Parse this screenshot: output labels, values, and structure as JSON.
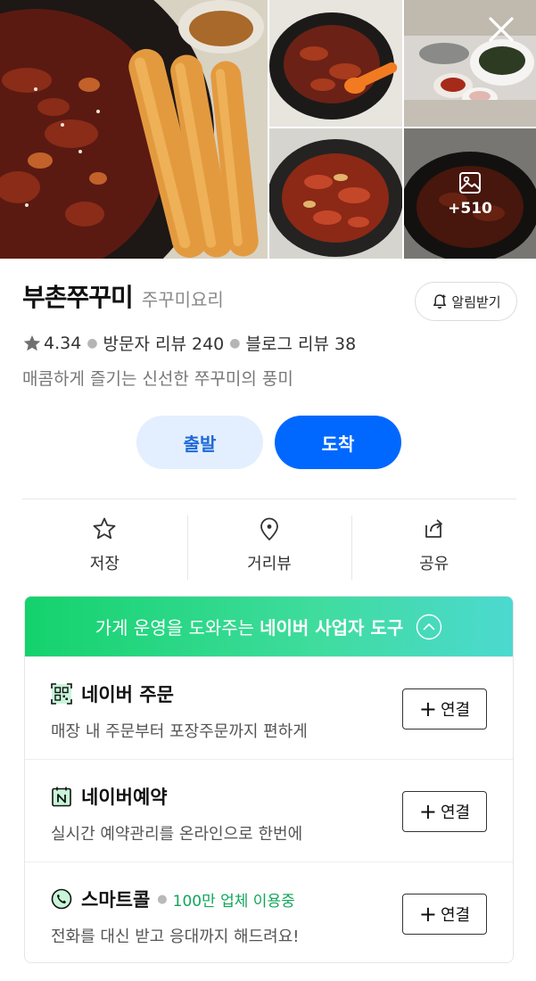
{
  "gallery": {
    "more_count": "+510",
    "icons": {
      "close": "close-icon",
      "more": "image-icon"
    }
  },
  "place": {
    "name": "부촌쭈꾸미",
    "category": "주꾸미요리",
    "alarm_label": "알림받기",
    "rating": "4.34",
    "visitor_reviews": "방문자 리뷰 240",
    "blog_reviews": "블로그 리뷰 38",
    "description": "매콤하게 즐기는 신선한 쭈꾸미의 풍미"
  },
  "route": {
    "depart_label": "출발",
    "arrive_label": "도착"
  },
  "actions": [
    {
      "label": "저장",
      "icon": "star-icon"
    },
    {
      "label": "거리뷰",
      "icon": "map-pin-icon"
    },
    {
      "label": "공유",
      "icon": "share-icon"
    }
  ],
  "tools": {
    "header_prefix": "가게 운영을 도와주는",
    "header_strong": "네이버 사업자 도구",
    "connect_label": "연결",
    "items": [
      {
        "title": "네이버 주문",
        "desc": "매장 내 주문부터 포장주문까지 편하게",
        "icon": "qr-code-icon",
        "badge": ""
      },
      {
        "title": "네이버예약",
        "desc": "실시간 예약관리를 온라인으로 한번에",
        "icon": "calendar-n-icon",
        "badge": ""
      },
      {
        "title": "스마트콜",
        "desc": "전화를 대신 받고 응대까지 해드려요!",
        "icon": "phone-icon",
        "badge": "100만 업체 이용중"
      }
    ]
  },
  "colors": {
    "accent_blue": "#0068ff",
    "light_blue": "#e3efff",
    "naver_green": "#14d26c",
    "badge_green": "#12a55b"
  }
}
